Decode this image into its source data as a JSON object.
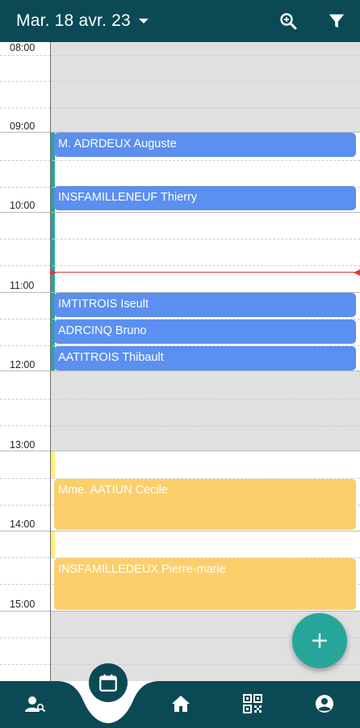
{
  "header": {
    "date_label": "Mar. 18 avr. 23",
    "icons": [
      "zoom-in-icon",
      "filter-icon"
    ],
    "background": "#0b4a55"
  },
  "calendar": {
    "hours": [
      "08:00",
      "09:00",
      "10:00",
      "11:00",
      "12:00",
      "13:00",
      "14:00",
      "15:00"
    ],
    "appointments": [
      {
        "name": "M. ADRDEUX Auguste",
        "color": "#5b8ff0"
      },
      {
        "name": "INSFAMILLENEUF Thierry",
        "color": "#5b8ff0"
      },
      {
        "name": "IMTITROIS Iseult",
        "color": "#5b8ff0"
      },
      {
        "name": "ADRCINQ Bruno",
        "color": "#5b8ff0"
      },
      {
        "name": "AATITROIS Thibault",
        "color": "#5b8ff0"
      },
      {
        "name": "Mme. AATIUN Cecile",
        "color": "#fccf6a"
      },
      {
        "name": "INSFAMILLEDEUX Pierre-marie",
        "color": "#fccf6a"
      }
    ],
    "current_time_indicator_color": "#e53935"
  },
  "fab": {
    "icon": "plus-icon",
    "color": "#26a69a"
  },
  "bottom_nav": {
    "items": [
      "patient-search-icon",
      "calendar-icon",
      "home-icon",
      "qr-code-icon",
      "account-icon"
    ],
    "active": "calendar-icon"
  }
}
